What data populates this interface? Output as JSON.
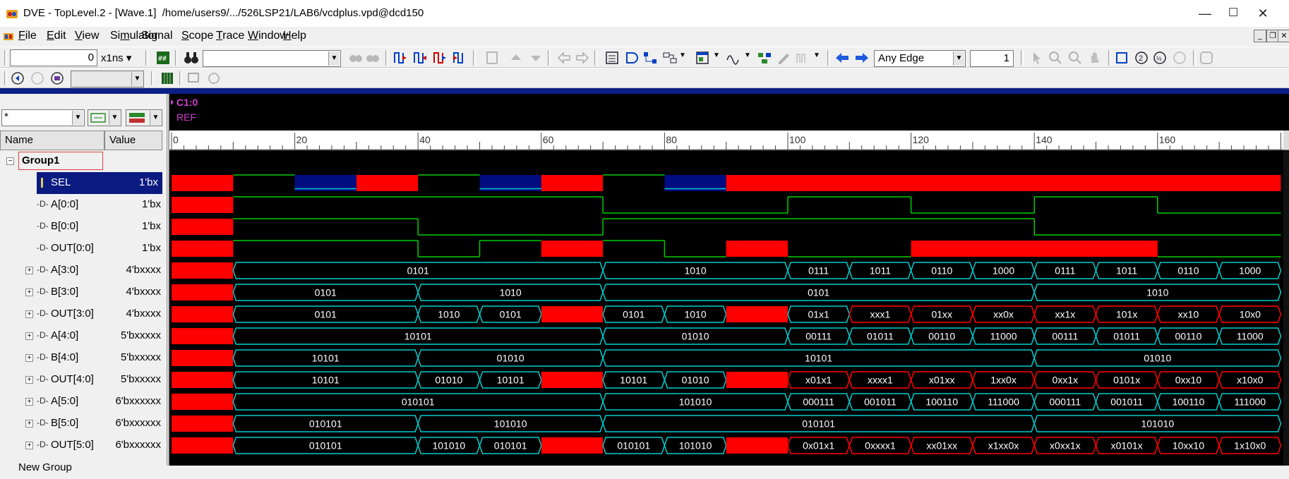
{
  "window": {
    "title": "DVE - TopLevel.2 - [Wave.1]  /home/users9/.../526LSP21/LAB6/vcdplus.vpd@dcd150",
    "minimize": "—",
    "maximize": "☐",
    "close": "✕"
  },
  "menu": [
    {
      "pre": "",
      "u": "F",
      "post": "ile"
    },
    {
      "pre": "",
      "u": "E",
      "post": "dit"
    },
    {
      "pre": "",
      "u": "V",
      "post": "iew"
    },
    {
      "pre": "Si",
      "u": "m",
      "post": "ulator"
    },
    {
      "pre": "Si",
      "u": "g",
      "post": "nal"
    },
    {
      "pre": "",
      "u": "S",
      "post": "cope"
    },
    {
      "pre": "",
      "u": "T",
      "post": "race"
    },
    {
      "pre": "",
      "u": "W",
      "post": "indow"
    },
    {
      "pre": "",
      "u": "H",
      "post": "elp"
    }
  ],
  "toolbar": {
    "time_value": "0",
    "time_unit": "x1ns",
    "search_value": "",
    "edge_mode": "Any Edge",
    "edge_count": "1"
  },
  "cursor": {
    "name": "C1:0",
    "ref": "REF"
  },
  "left_pane": {
    "filter_value": "*",
    "col_name": "Name",
    "col_value": "Value",
    "group": "Group1",
    "signals": [
      {
        "name": "SEL",
        "value": "1'bx",
        "expandable": false
      },
      {
        "name": "A[0:0]",
        "value": "1'bx",
        "expandable": false
      },
      {
        "name": "B[0:0]",
        "value": "1'bx",
        "expandable": false
      },
      {
        "name": "OUT[0:0]",
        "value": "1'bx",
        "expandable": false
      },
      {
        "name": "A[3:0]",
        "value": "4'bxxxx",
        "expandable": true
      },
      {
        "name": "B[3:0]",
        "value": "4'bxxxx",
        "expandable": true
      },
      {
        "name": "OUT[3:0]",
        "value": "4'bxxxx",
        "expandable": true
      },
      {
        "name": "A[4:0]",
        "value": "5'bxxxxx",
        "expandable": true
      },
      {
        "name": "B[4:0]",
        "value": "5'bxxxxx",
        "expandable": true
      },
      {
        "name": "OUT[4:0]",
        "value": "5'bxxxxx",
        "expandable": true
      },
      {
        "name": "A[5:0]",
        "value": "6'bxxxxxx",
        "expandable": true
      },
      {
        "name": "B[5:0]",
        "value": "6'bxxxxxx",
        "expandable": true
      },
      {
        "name": "OUT[5:0]",
        "value": "6'bxxxxxx",
        "expandable": true
      }
    ],
    "next_group": "New Group"
  },
  "ruler": {
    "start": 0,
    "end": 180,
    "major_step": 20,
    "labels": [
      "0",
      "20",
      "40",
      "60",
      "80",
      "100",
      "120",
      "140",
      "160"
    ]
  },
  "colors": {
    "scalar": "#00cc00",
    "bus": "#00cccc",
    "x": "#ff0000",
    "z": "#000c80"
  },
  "traces": [
    {
      "type": "scalar",
      "segs": [
        [
          0,
          10,
          "x"
        ],
        [
          10,
          20,
          "1"
        ],
        [
          20,
          30,
          "z"
        ],
        [
          30,
          40,
          "x"
        ],
        [
          40,
          50,
          "1"
        ],
        [
          50,
          60,
          "z"
        ],
        [
          60,
          70,
          "x"
        ],
        [
          70,
          80,
          "1"
        ],
        [
          80,
          90,
          "z"
        ],
        [
          90,
          180,
          "x"
        ]
      ]
    },
    {
      "type": "scalar",
      "segs": [
        [
          0,
          10,
          "x"
        ],
        [
          10,
          70,
          "1"
        ],
        [
          70,
          100,
          "0"
        ],
        [
          100,
          120,
          "1"
        ],
        [
          120,
          140,
          "0"
        ],
        [
          140,
          160,
          "1"
        ],
        [
          160,
          180,
          "0"
        ]
      ]
    },
    {
      "type": "scalar",
      "segs": [
        [
          0,
          10,
          "x"
        ],
        [
          10,
          40,
          "1"
        ],
        [
          40,
          70,
          "0"
        ],
        [
          70,
          140,
          "1"
        ],
        [
          140,
          180,
          "0"
        ]
      ]
    },
    {
      "type": "scalar",
      "segs": [
        [
          0,
          10,
          "x"
        ],
        [
          10,
          40,
          "1"
        ],
        [
          40,
          50,
          "0"
        ],
        [
          50,
          60,
          "1"
        ],
        [
          60,
          70,
          "x"
        ],
        [
          70,
          80,
          "1"
        ],
        [
          80,
          90,
          "0"
        ],
        [
          90,
          100,
          "x"
        ],
        [
          100,
          120,
          "0"
        ],
        [
          120,
          160,
          "x"
        ],
        [
          160,
          180,
          "0"
        ]
      ]
    },
    {
      "type": "bus",
      "segs": [
        [
          0,
          10,
          "x",
          ""
        ],
        [
          10,
          70,
          "v",
          "0101"
        ],
        [
          70,
          100,
          "v",
          "1010"
        ],
        [
          100,
          110,
          "v",
          "0111"
        ],
        [
          110,
          120,
          "v",
          "1011"
        ],
        [
          120,
          130,
          "v",
          "0110"
        ],
        [
          130,
          140,
          "v",
          "1000"
        ],
        [
          140,
          150,
          "v",
          "0111"
        ],
        [
          150,
          160,
          "v",
          "1011"
        ],
        [
          160,
          170,
          "v",
          "0110"
        ],
        [
          170,
          180,
          "v",
          "1000"
        ]
      ]
    },
    {
      "type": "bus",
      "segs": [
        [
          0,
          10,
          "x",
          ""
        ],
        [
          10,
          40,
          "v",
          "0101"
        ],
        [
          40,
          70,
          "v",
          "1010"
        ],
        [
          70,
          140,
          "v",
          "0101"
        ],
        [
          140,
          180,
          "v",
          "1010"
        ]
      ]
    },
    {
      "type": "bus",
      "segs": [
        [
          0,
          10,
          "x",
          ""
        ],
        [
          10,
          40,
          "v",
          "0101"
        ],
        [
          40,
          50,
          "v",
          "1010"
        ],
        [
          50,
          60,
          "v",
          "0101"
        ],
        [
          60,
          70,
          "x",
          ""
        ],
        [
          70,
          80,
          "v",
          "0101"
        ],
        [
          80,
          90,
          "v",
          "1010"
        ],
        [
          90,
          100,
          "x",
          ""
        ],
        [
          100,
          110,
          "v",
          "01x1"
        ],
        [
          110,
          120,
          "xv",
          "xxx1"
        ],
        [
          120,
          130,
          "xv",
          "01xx"
        ],
        [
          130,
          140,
          "xv",
          "xx0x"
        ],
        [
          140,
          150,
          "xv",
          "xx1x"
        ],
        [
          150,
          160,
          "xv",
          "101x"
        ],
        [
          160,
          170,
          "xv",
          "xx10"
        ],
        [
          170,
          180,
          "xv",
          "10x0"
        ]
      ]
    },
    {
      "type": "bus",
      "segs": [
        [
          0,
          10,
          "x",
          ""
        ],
        [
          10,
          70,
          "v",
          "10101"
        ],
        [
          70,
          100,
          "v",
          "01010"
        ],
        [
          100,
          110,
          "v",
          "00111"
        ],
        [
          110,
          120,
          "v",
          "01011"
        ],
        [
          120,
          130,
          "v",
          "00110"
        ],
        [
          130,
          140,
          "v",
          "11000"
        ],
        [
          140,
          150,
          "v",
          "00111"
        ],
        [
          150,
          160,
          "v",
          "01011"
        ],
        [
          160,
          170,
          "v",
          "00110"
        ],
        [
          170,
          180,
          "v",
          "11000"
        ]
      ]
    },
    {
      "type": "bus",
      "segs": [
        [
          0,
          10,
          "x",
          ""
        ],
        [
          10,
          40,
          "v",
          "10101"
        ],
        [
          40,
          70,
          "v",
          "01010"
        ],
        [
          70,
          140,
          "v",
          "10101"
        ],
        [
          140,
          180,
          "v",
          "01010"
        ]
      ]
    },
    {
      "type": "bus",
      "segs": [
        [
          0,
          10,
          "x",
          ""
        ],
        [
          10,
          40,
          "v",
          "10101"
        ],
        [
          40,
          50,
          "v",
          "01010"
        ],
        [
          50,
          60,
          "v",
          "10101"
        ],
        [
          60,
          70,
          "x",
          ""
        ],
        [
          70,
          80,
          "v",
          "10101"
        ],
        [
          80,
          90,
          "v",
          "01010"
        ],
        [
          90,
          100,
          "x",
          ""
        ],
        [
          100,
          110,
          "xv",
          "x01x1"
        ],
        [
          110,
          120,
          "xv",
          "xxxx1"
        ],
        [
          120,
          130,
          "xv",
          "x01xx"
        ],
        [
          130,
          140,
          "xv",
          "1xx0x"
        ],
        [
          140,
          150,
          "xv",
          "0xx1x"
        ],
        [
          150,
          160,
          "xv",
          "0101x"
        ],
        [
          160,
          170,
          "xv",
          "0xx10"
        ],
        [
          170,
          180,
          "xv",
          "x10x0"
        ]
      ]
    },
    {
      "type": "bus",
      "segs": [
        [
          0,
          10,
          "x",
          ""
        ],
        [
          10,
          70,
          "v",
          "010101"
        ],
        [
          70,
          100,
          "v",
          "101010"
        ],
        [
          100,
          110,
          "v",
          "000111"
        ],
        [
          110,
          120,
          "v",
          "001011"
        ],
        [
          120,
          130,
          "v",
          "100110"
        ],
        [
          130,
          140,
          "v",
          "111000"
        ],
        [
          140,
          150,
          "v",
          "000111"
        ],
        [
          150,
          160,
          "v",
          "001011"
        ],
        [
          160,
          170,
          "v",
          "100110"
        ],
        [
          170,
          180,
          "v",
          "111000"
        ]
      ]
    },
    {
      "type": "bus",
      "segs": [
        [
          0,
          10,
          "x",
          ""
        ],
        [
          10,
          40,
          "v",
          "010101"
        ],
        [
          40,
          70,
          "v",
          "101010"
        ],
        [
          70,
          140,
          "v",
          "010101"
        ],
        [
          140,
          180,
          "v",
          "101010"
        ]
      ]
    },
    {
      "type": "bus",
      "segs": [
        [
          0,
          10,
          "x",
          ""
        ],
        [
          10,
          40,
          "v",
          "010101"
        ],
        [
          40,
          50,
          "v",
          "101010"
        ],
        [
          50,
          60,
          "v",
          "010101"
        ],
        [
          60,
          70,
          "x",
          ""
        ],
        [
          70,
          80,
          "v",
          "010101"
        ],
        [
          80,
          90,
          "v",
          "101010"
        ],
        [
          90,
          100,
          "x",
          ""
        ],
        [
          100,
          110,
          "xv",
          "0x01x1"
        ],
        [
          110,
          120,
          "xv",
          "0xxxx1"
        ],
        [
          120,
          130,
          "xv",
          "xx01xx"
        ],
        [
          130,
          140,
          "xv",
          "x1xx0x"
        ],
        [
          140,
          150,
          "xv",
          "x0xx1x"
        ],
        [
          150,
          160,
          "xv",
          "x0101x"
        ],
        [
          160,
          170,
          "xv",
          "10xx10"
        ],
        [
          170,
          180,
          "xv",
          "1x10x0"
        ]
      ]
    }
  ]
}
